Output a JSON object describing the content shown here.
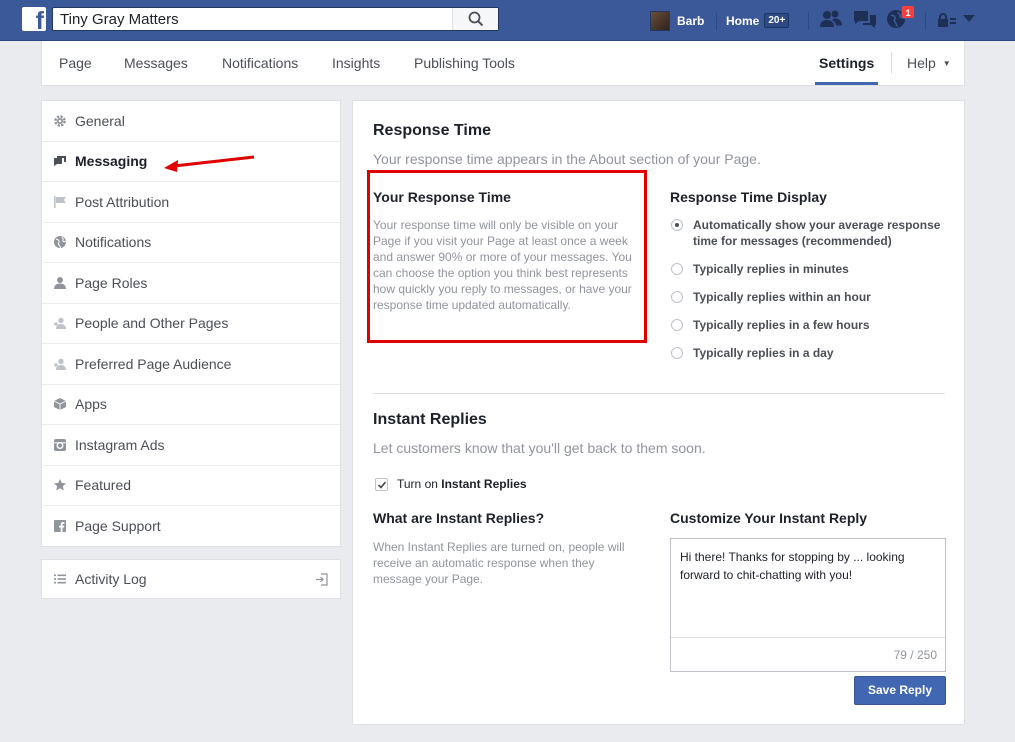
{
  "topbar": {
    "search_value": "Tiny Gray Matters",
    "user_name": "Barb",
    "home_label": "Home",
    "home_count": "20+",
    "notifications_count": "1"
  },
  "page_nav": {
    "tabs": [
      "Page",
      "Messages",
      "Notifications",
      "Insights",
      "Publishing Tools"
    ],
    "settings": "Settings",
    "help": "Help"
  },
  "sidebar": {
    "items": [
      {
        "label": "General",
        "icon": "gear-icon"
      },
      {
        "label": "Messaging",
        "icon": "chat-icon"
      },
      {
        "label": "Post Attribution",
        "icon": "flag-icon"
      },
      {
        "label": "Notifications",
        "icon": "globe-icon"
      },
      {
        "label": "Page Roles",
        "icon": "person-icon"
      },
      {
        "label": "People and Other Pages",
        "icon": "add-person-icon"
      },
      {
        "label": "Preferred Page Audience",
        "icon": "add-person-icon"
      },
      {
        "label": "Apps",
        "icon": "cube-icon"
      },
      {
        "label": "Instagram Ads",
        "icon": "instagram-icon"
      },
      {
        "label": "Featured",
        "icon": "star-icon"
      },
      {
        "label": "Page Support",
        "icon": "facebook-icon"
      }
    ],
    "activity_log": "Activity Log"
  },
  "response_time": {
    "title": "Response Time",
    "subtitle": "Your response time appears in the About section of your Page.",
    "your_title": "Your Response Time",
    "your_text": "Your response time will only be visible on your Page if you visit your Page at least once a week and answer 90% or more of your messages. You can choose the option you think best represents how quickly you reply to messages, or have your response time updated automatically.",
    "display_title": "Response Time Display",
    "options": [
      "Automatically show your average response time for messages (recommended)",
      "Typically replies in minutes",
      "Typically replies within an hour",
      "Typically replies in a few hours",
      "Typically replies in a day"
    ],
    "selected_option": 0
  },
  "instant_replies": {
    "title": "Instant Replies",
    "subtitle": "Let customers know that you'll get back to them soon.",
    "checkbox_prefix": "Turn on ",
    "checkbox_bold": "Instant Replies",
    "checked": true,
    "what_title": "What are Instant Replies?",
    "what_text": "When Instant Replies are turned on, people will receive an automatic response when they message your Page.",
    "customize_title": "Customize Your Instant Reply",
    "reply_text": "Hi there! Thanks for stopping by ... looking forward to chit-chatting with you!",
    "char_count": "79 / 250",
    "save_label": "Save Reply"
  },
  "colors": {
    "brand": "#3b5998",
    "button": "#4267b2",
    "highlight": "#e00000"
  }
}
